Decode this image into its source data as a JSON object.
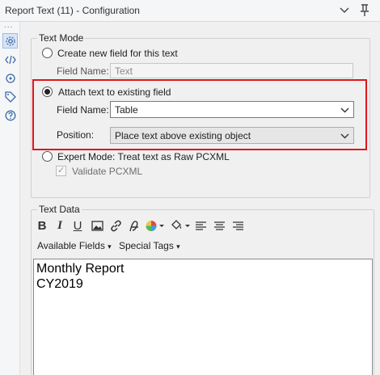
{
  "window": {
    "title": "Report Text (11) - Configuration",
    "icons": {
      "collapse": "chevron-down-icon",
      "pin": "pin-icon"
    }
  },
  "sidebar": {
    "overflow": "...",
    "icons": [
      "gear-icon",
      "code-icon",
      "crosshair-icon",
      "tag-icon",
      "help-icon"
    ]
  },
  "text_mode": {
    "legend": "Text Mode",
    "create_new": {
      "label": "Create new field for this text",
      "field_label": "Field Name:",
      "field_value": "Text"
    },
    "attach_existing": {
      "label": "Attach text to existing field",
      "field_label": "Field Name:",
      "field_value": "Table",
      "position_label": "Position:",
      "position_value": "Place text above existing object"
    },
    "expert": {
      "label": "Expert Mode: Treat text as Raw PCXML",
      "validate_label": "Validate PCXML"
    },
    "selected": "attach_existing"
  },
  "text_data": {
    "legend": "Text Data",
    "toolbar": {
      "icons": [
        "bold-icon",
        "italic-icon",
        "underline-icon",
        "image-icon",
        "link-icon",
        "font-icon",
        "color-picker-icon",
        "fill-color-icon",
        "align-left-icon",
        "align-center-icon",
        "align-right-icon"
      ],
      "bold": "B",
      "italic": "I",
      "underline": "U"
    },
    "menus": {
      "available_fields": "Available Fields",
      "special_tags": "Special Tags"
    },
    "content_lines": [
      "Monthly Report",
      "CY2019"
    ]
  },
  "colors": {
    "highlight_border": "#e0151c",
    "accent": "#3a6aa8"
  }
}
